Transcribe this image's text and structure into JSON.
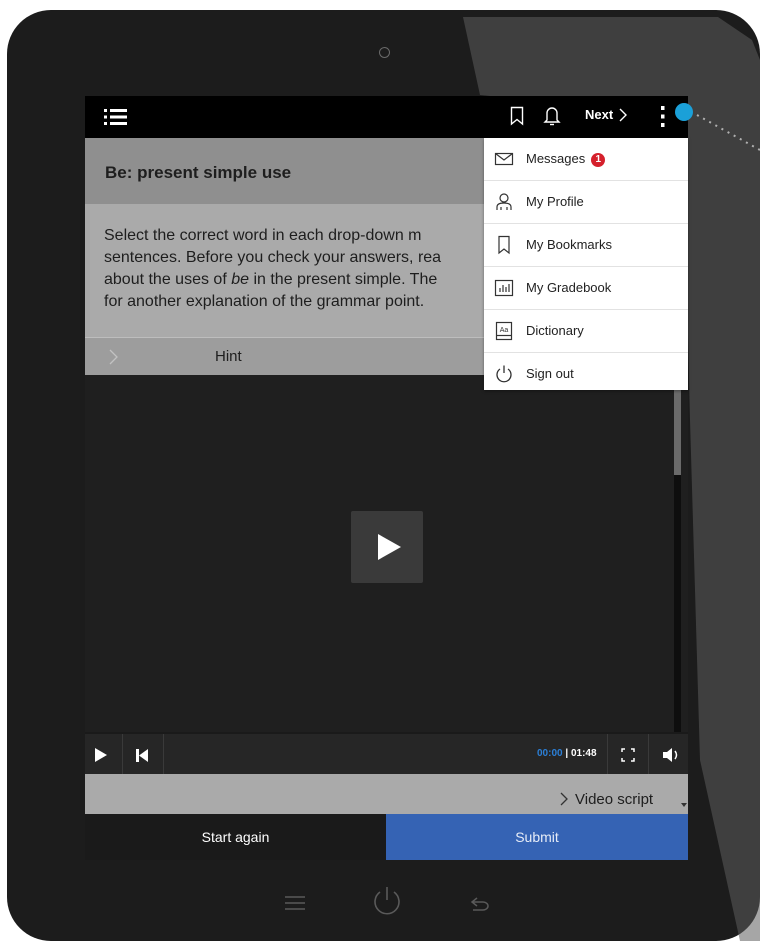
{
  "topbar": {
    "menu_icon": "list-menu-icon",
    "bookmark_icon": "bookmark-icon",
    "bell_icon": "bell-icon",
    "next_label": "Next",
    "more_icon": "more-vertical-icon"
  },
  "lesson": {
    "title": "Be: present simple use",
    "instructions_lines": [
      "Select the correct word in each drop-down m",
      "sentences. Before you check your answers, rea",
      "about the uses of ",
      "for another explanation of the grammar point."
    ],
    "instructions_line3_italic": "be",
    "instructions_line3_rest": " in the present simple. The",
    "hint_label": "Hint"
  },
  "video": {
    "current_time": "00:00",
    "separator": "|",
    "duration": "01:48",
    "script_label": "Video script"
  },
  "actions": {
    "start_again": "Start again",
    "submit": "Submit"
  },
  "dropdown_menu": {
    "items": [
      {
        "label": "Messages",
        "icon": "envelope-icon",
        "badge": "1"
      },
      {
        "label": "My Profile",
        "icon": "user-icon"
      },
      {
        "label": "My Bookmarks",
        "icon": "bookmark-icon"
      },
      {
        "label": "My Gradebook",
        "icon": "gradebook-icon"
      },
      {
        "label": "Dictionary",
        "icon": "dictionary-icon"
      },
      {
        "label": "Sign out",
        "icon": "power-icon"
      }
    ]
  },
  "colors": {
    "accent": "#3563b4",
    "badge": "#d5202c",
    "indicator": "#1ba0d8",
    "time_current": "#2b7fd6"
  }
}
